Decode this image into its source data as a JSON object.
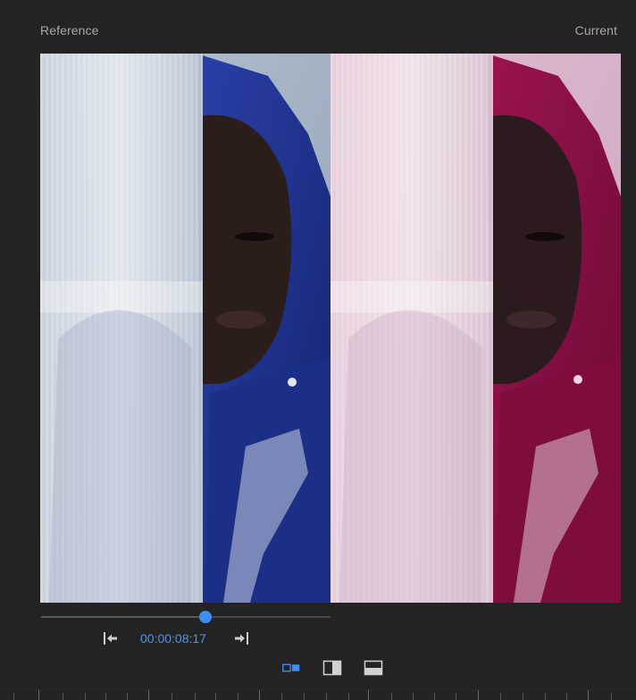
{
  "labels": {
    "reference": "Reference",
    "current": "Current"
  },
  "playback": {
    "timecode": "00:00:08:17",
    "progress": 0.57
  },
  "icons": {
    "prev": "go-to-previous-edit-icon",
    "next": "go-to-next-edit-icon",
    "side_by_side": "side-by-side-view-icon",
    "vertical_split": "vertical-split-view-icon",
    "horizontal_split": "horizontal-split-view-icon"
  },
  "colors": {
    "background": "#232323",
    "accent": "#3d8ef3",
    "timecode": "#4f95ee",
    "label": "#a8a8a8",
    "reference_jacket": "#1c2f86",
    "current_jacket": "#7e0c3c"
  },
  "view_modes": {
    "active": "side_by_side"
  }
}
